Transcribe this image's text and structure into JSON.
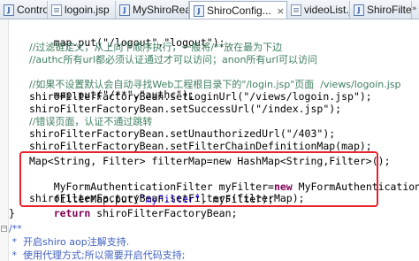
{
  "tabs": [
    {
      "label": "Controll...",
      "icon": "java-file-icon"
    },
    {
      "label": "logoin.jsp",
      "icon": "jsp-file-icon"
    },
    {
      "label": "MyShiroRealm...",
      "icon": "java-file-icon"
    },
    {
      "label": "ShiroConfig...",
      "icon": "java-file-icon",
      "active": true,
      "close": "×"
    },
    {
      "label": "videoList.jsp",
      "icon": "jsp-file-icon"
    },
    {
      "label": "ShiroFilterF...",
      "icon": "java-file-icon"
    }
  ],
  "overflow_label": "»",
  "code": {
    "l1": "map.put(\"/logout\",\"logout\");",
    "l2": "//过滤链定义，从上向下顺序执行，一般将/**放在最为下边",
    "l3": "//authc所有url都必须认证通过才可以访问；anon所有url可以访问",
    "l4": "map.put(\"/**\",\"authc\");",
    "l5": "//如果不设置默认会自动寻找Web工程根目录下的\"/login.jsp\"页面  /views/logoin.jsp",
    "l6": "shiroFilterFactoryBean.setLoginUrl(\"/views/logoin.jsp\");",
    "l7": "shiroFilterFactoryBean.setSuccessUrl(\"/index.jsp\");",
    "l8": "//错误页面，认证不通过跳转",
    "l9": "shiroFilterFactoryBean.setUnauthorizedUrl(\"/403\");",
    "l10": "shiroFilterFactoryBean.setFilterChainDefinitionMap(map);",
    "l11": "Map<String, Filter> filterMap=new HashMap<String,Filter>();",
    "l12a": "MyFormAuthenticationFilter myFilter=",
    "l12kw": "new",
    "l12b": " MyFormAuthenticationFilter();",
    "l13a": "filterMap.put(",
    "l13s": "\"myFilter\"",
    "l13b": ", myFilter);",
    "l14": "shiroFilterFactoryBean.setFilters(filterMap);",
    "l15kw": "return",
    "l15b": " shiroFilterFactoryBean;",
    "l16": "}",
    "l17": "/**",
    "l18": " *  开启shiro aop注解支持.",
    "l19": " *  使用代理方式;所以需要开启代码支持;"
  },
  "colors": {
    "comment": "#3f7f5f",
    "javadoc": "#3f5fbf",
    "string": "#2a00ff",
    "keyword": "#7f0055",
    "highlight_box": "#e8232b"
  }
}
